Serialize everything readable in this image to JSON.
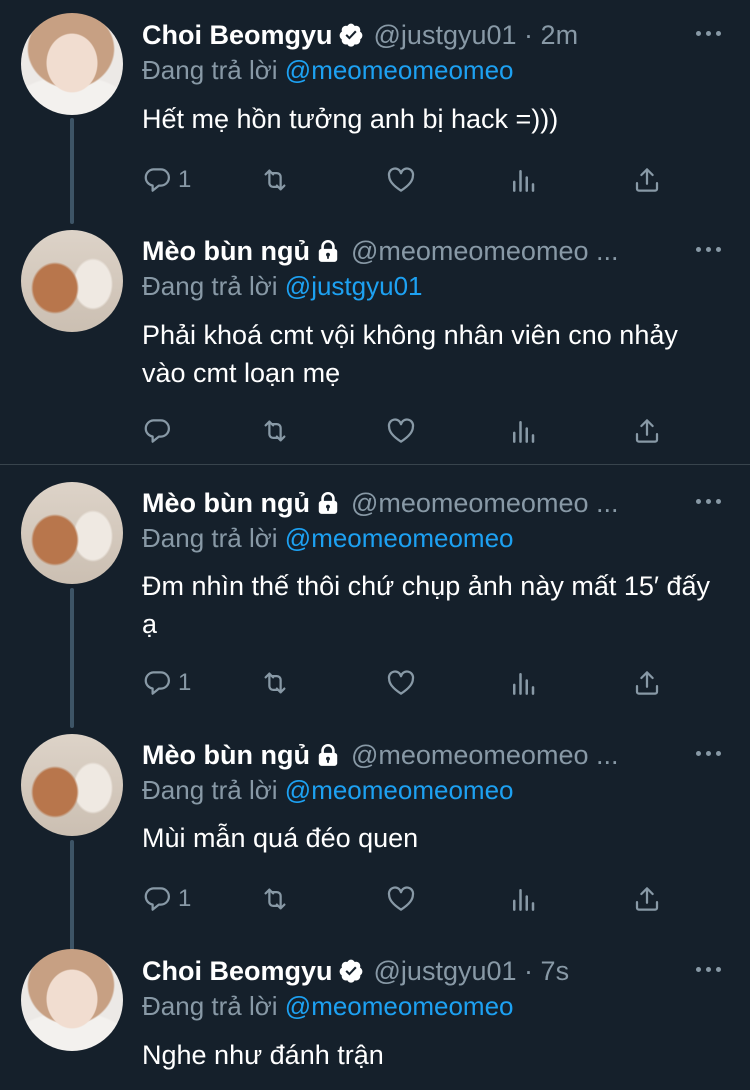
{
  "replying_prefix": "Đang trả lời",
  "tweets": [
    {
      "name": "Choi Beomgyu",
      "handle": "@justgyu01",
      "dot": "·",
      "time": "2m",
      "reply_to": "@meomeomeomeo",
      "text": "Hết mẹ hồn tưởng anh bị hack =)))",
      "replies": "1",
      "badge": "verified-icon",
      "avatar": "avatar-person"
    },
    {
      "name": "Mèo bùn ngủ",
      "handle": "@meomeomeomeo ...",
      "reply_to": "@justgyu01",
      "text": "Phải khoá cmt vội không nhân viên cno nhảy vào cmt loạn mẹ",
      "replies": "",
      "badge": "lock-icon",
      "avatar": "avatar-cats"
    },
    {
      "name": "Mèo bùn ngủ",
      "handle": "@meomeomeomeo ...",
      "reply_to": "@meomeomeomeo",
      "text": "Đm nhìn thế thôi chứ chụp ảnh này mất 15′ đấy ạ",
      "replies": "1",
      "badge": "lock-icon",
      "avatar": "avatar-cats"
    },
    {
      "name": "Mèo bùn ngủ",
      "handle": "@meomeomeomeo ...",
      "reply_to": "@meomeomeomeo",
      "text": "Mùi mẫn quá đéo quen",
      "replies": "1",
      "badge": "lock-icon",
      "avatar": "avatar-cats"
    },
    {
      "name": "Choi Beomgyu",
      "handle": "@justgyu01",
      "dot": "·",
      "time": "7s",
      "reply_to": "@meomeomeomeo",
      "text": "Nghe như đánh trận",
      "badge": "verified-icon",
      "avatar": "avatar-person"
    }
  ],
  "colors": {
    "background": "#15202b",
    "secondary_text": "#8899a6",
    "link": "#1da1f2",
    "divider": "#38444d"
  }
}
